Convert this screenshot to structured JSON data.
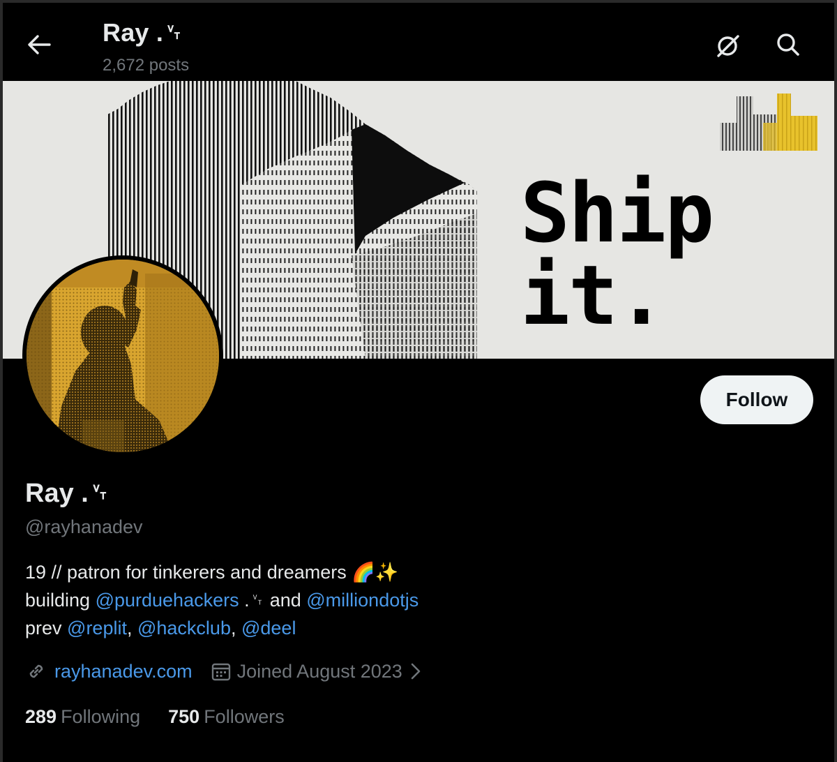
{
  "header": {
    "title": "Ray .␋",
    "posts_count": "2,672 posts",
    "back_icon": "arrow-left-icon",
    "grok_icon": "grok-icon",
    "search_icon": "search-icon"
  },
  "banner": {
    "headline": "Ship it.",
    "colors": {
      "background": "#e6e6e3",
      "accent": "#e8c22c"
    }
  },
  "profile": {
    "display_name": "Ray .␋",
    "handle": "@rayhanadev",
    "follow_label": "Follow",
    "bio": {
      "line1": {
        "text": "19 // patron for tinkerers and dreamers 🌈✨"
      },
      "line2": {
        "prefix": "building ",
        "mention1": "@purduehackers",
        "middle": " .␋ and ",
        "mention2": "@milliondotjs"
      },
      "line3": {
        "prefix": "prev ",
        "mention1": "@replit",
        "sep1": ", ",
        "mention2": "@hackclub",
        "sep2": ", ",
        "mention3": "@deel"
      }
    },
    "website": "rayhanadev.com",
    "joined": "Joined August 2023",
    "following_count": "289",
    "following_label": "Following",
    "followers_count": "750",
    "followers_label": "Followers"
  },
  "colors": {
    "background": "#000000",
    "text_primary": "#e7e9ea",
    "text_secondary": "#71767b",
    "link": "#4a99e9",
    "follow_button_bg": "#eff3f4"
  }
}
